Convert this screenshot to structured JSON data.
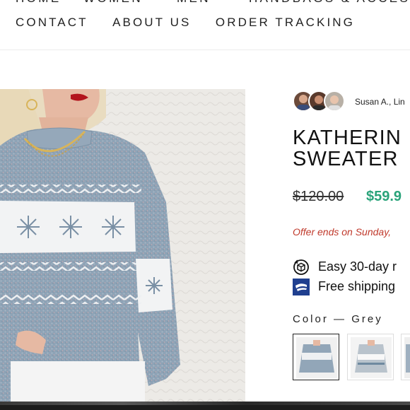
{
  "nav": {
    "top_row": [
      "HOME",
      "WOMEN",
      "MEN",
      "HANDBAGS & ACCES"
    ],
    "second_row": [
      "CONTACT",
      "ABOUT US",
      "ORDER TRACKING"
    ]
  },
  "product": {
    "reviewers_text": "Susan A., Lin",
    "title_line1": "KATHERIN",
    "title_line2": "SWEATER",
    "price_original": "$120.00",
    "price_sale": "$59.9",
    "offer_text": "Offer ends on Sunday,",
    "perks": [
      {
        "icon": "returns-box-icon",
        "text": "Easy 30-day r"
      },
      {
        "icon": "usps-shipping-icon",
        "text": "Free shipping"
      }
    ],
    "color_label": "Color",
    "color_separator": "—",
    "color_value": "Grey"
  },
  "colors": {
    "sale_price": "#2aa37a",
    "offer_text": "#c0392b"
  }
}
